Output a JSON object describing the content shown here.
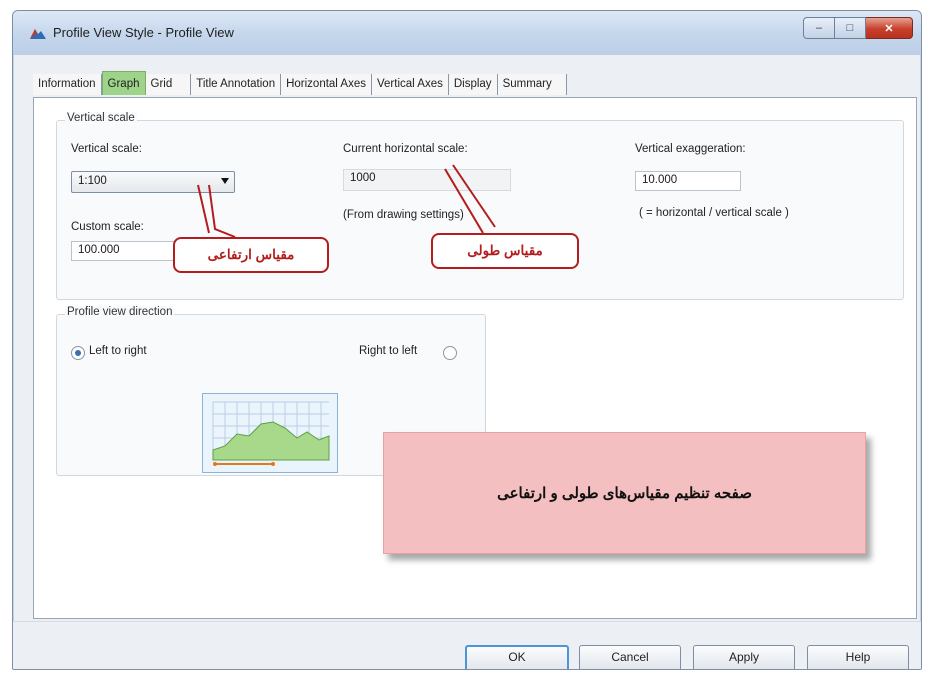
{
  "window": {
    "title": "Profile View Style - Profile View",
    "controls": {
      "minimize": "–",
      "maximize": "□",
      "close": "✕"
    }
  },
  "tabs": [
    {
      "label": "Information",
      "active": false
    },
    {
      "label": "Graph",
      "active": true
    },
    {
      "label": "Grid",
      "active": false
    },
    {
      "label": "Title Annotation",
      "active": false
    },
    {
      "label": "Horizontal Axes",
      "active": false
    },
    {
      "label": "Vertical Axes",
      "active": false
    },
    {
      "label": "Display",
      "active": false
    },
    {
      "label": "Summary",
      "active": false
    }
  ],
  "vertical_scale_group": {
    "title": "Vertical scale",
    "vertical_scale_label": "Vertical scale:",
    "vertical_scale_value": "1:100",
    "custom_scale_label": "Custom scale:",
    "custom_scale_value": "100.000",
    "current_horizontal_label": "Current horizontal scale:",
    "current_horizontal_value": "1000",
    "from_drawing_note": "(From drawing settings)",
    "exaggeration_label": "Vertical exaggeration:",
    "exaggeration_value": "10.000",
    "exaggeration_note": "( = horizontal / vertical scale )"
  },
  "direction_group": {
    "title": "Profile view direction",
    "left_to_right": "Left to right",
    "right_to_left": "Right to left",
    "selected": "left_to_right"
  },
  "annotations": {
    "vertical_callout": "مقیاس ارتفاعی",
    "horizontal_callout": "مقیاس طولی",
    "caption": "صفحه تنظیم مقیاس‌های طولی و ارتفاعی"
  },
  "buttons": {
    "ok": "OK",
    "cancel": "Cancel",
    "apply": "Apply",
    "help": "Help"
  },
  "colors": {
    "active_tab": "#9ed38a",
    "callout_red": "#b31d1d",
    "caption_pink": "#f4bfc0",
    "ok_border": "#4d96d6"
  },
  "icons": [
    "app-icon",
    "minimize-icon",
    "maximize-icon",
    "close-icon",
    "dropdown-arrow-icon",
    "profile-preview-icon"
  ]
}
